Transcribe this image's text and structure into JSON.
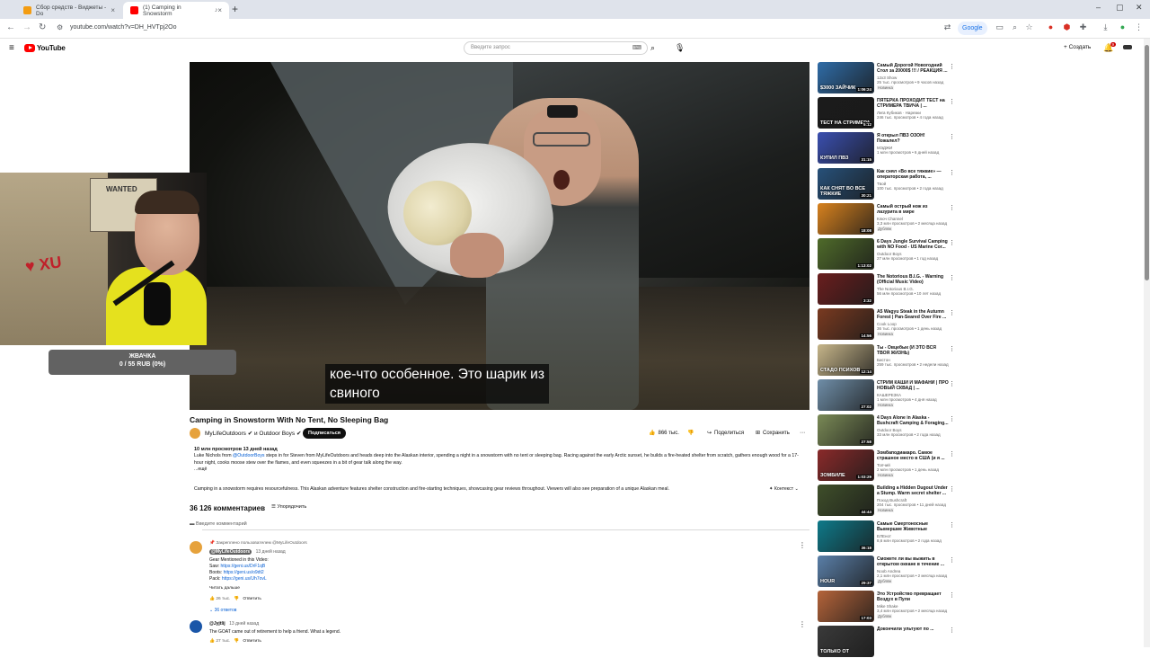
{
  "browser": {
    "tabs": [
      {
        "title": "Сбор средств - Виджеты - Do",
        "active": false,
        "favicon_color": "#f39c12"
      },
      {
        "title": "(1) Camping in Snowstorm",
        "active": true,
        "favicon_color": "#ff0000"
      }
    ],
    "url": "youtube.com/watch?v=DH_HVTpj2Oo",
    "google_button": "Google"
  },
  "masthead": {
    "logo_text": "YouTube",
    "search_placeholder": "Введите запрос",
    "create_label": "Создать",
    "notifications_count": "9"
  },
  "player": {
    "subtitle_line1": "кое-что особенное.  Это шарик из",
    "subtitle_line2": "свиного"
  },
  "overlay": {
    "donation_title": "ЖВАЧКА",
    "donation_progress": "0 / 55 RUB (0%)",
    "donation_fraction": 0
  },
  "video": {
    "title": "Camping in Snowstorm With No Tent, No Sleeping Bag",
    "channel": "MyLifeOutdoors",
    "channel_suffix": "и Outdoor Boys",
    "subscribe_label": "Подписаться",
    "likes": "866 тыс.",
    "share_label": "Поделиться",
    "save_label": "Сохранить",
    "stats": "10 млн просмотров  13 дней назад",
    "description_line1_a": "Luke Nichols from ",
    "description_link": "@OutdoorBoys",
    "description_line1_b": "  steps in for Steven from MyLifeOutdoors and heads deep into the Alaskan interior, spending a night in a snowstorm with no tent or sleeping bag. Racing against the early Arctic sunset, he builds a fire-heated shelter from scratch, gathers enough wood for a 17-",
    "description_line2": "hour night, cooks moose stew over the flames, and even squeezes in a bit of gear talk along the way.",
    "more_label": "...ещё",
    "summary": "Camping in a snowstorm requires resourcefulness. This Alaskan adventure features shelter construction and fire-starting techniques, showcasing gear reviews throughout. Viewers will also see preparation of a unique Alaskan meal.",
    "context_label": "Контекст"
  },
  "comments": {
    "count": "36 126 комментариев",
    "sort_label": "Упорядочить",
    "input_placeholder": "Введите комментарий",
    "items": [
      {
        "pinned_label": "Закреплено пользователем @MyLifeOutdoors",
        "author": "@MyLifeOutdoors",
        "time": "13 дней назад",
        "lines": [
          {
            "text": "Gear Mentioned in this Video:",
            "link": ""
          },
          {
            "text": "Saw: ",
            "link": "https://geni.us/DrF1qB"
          },
          {
            "text": "Boots: ",
            "link": "https://geni.us/o9dt2"
          },
          {
            "text": "Pack: ",
            "link": "https://geni.us/Uh7ovL"
          }
        ],
        "read_more": "Читать дальше",
        "likes": "26 тыс.",
        "reply_label": "Ответить",
        "replies_label": "36 ответов",
        "avatar_color": "#e6a23c"
      },
      {
        "author": "@Jyjtlij",
        "time": "13 дней назад",
        "lines": [
          {
            "text": "The GOAT came out of retirement to help a friend.  What a legend.",
            "link": ""
          }
        ],
        "likes": "27 тыс.",
        "reply_label": "Ответить",
        "avatar_color": "#1a56a8"
      }
    ]
  },
  "sidebar": [
    {
      "title": "Самый Дорогой Новогодний Стол за 20000$ !!! / РЕАКЦИЯ ...",
      "channel": "12x3 Show",
      "stats": "25 тыс. просмотров • 9 часов назад",
      "badge": "Новинка",
      "duration": "1:06:24",
      "overlay": "$3000 ЗАЙЧИК",
      "color": "#2f6ca7"
    },
    {
      "title": "ПЯТЁРКА ПРОХОДИТ ТЕСТ на СТРИМЕРА ТВИЧА | ...",
      "channel": "Лига Кубиков · Нарезки",
      "stats": "246 тыс. просмотров • 4 года назад",
      "badge": "",
      "duration": "5:12",
      "overlay": "ТЕСТ НА СТРИМЕРА",
      "color": "#1b1b1b"
    },
    {
      "title": "Я открыл ПВЗ ОЗОН! Пожалел?",
      "channel": "МЭДЖИ",
      "stats": "1 млн просмотров • 6 дней назад",
      "badge": "",
      "duration": "31:15",
      "overlay": "КУПИЛ ПВЗ",
      "color": "#3a4fb0"
    },
    {
      "title": "Как снял «Во все тяжкие» — операторская работа, ...",
      "channel": "Tвой",
      "stats": "100 тыс. просмотров • 2 года назад",
      "badge": "",
      "duration": "30:21",
      "overlay": "КАК СНЯТ ВО ВСЕ ТЯЖКИЕ",
      "color": "#27517a"
    },
    {
      "title": "Самый острый нож из лазурита в мире",
      "channel": "Ключ Channel",
      "stats": "3,3 млн просмотров • 2 месяца назад",
      "badge": "Дубляж",
      "duration": "18:08",
      "overlay": "",
      "color": "#d8821e"
    },
    {
      "title": "6 Days Jungle Survival Camping with NO Food - US Marine Cor...",
      "channel": "Outdoor Boys",
      "stats": "27 млн просмотров • 1 год назад",
      "badge": "",
      "duration": "1:13:02",
      "overlay": "",
      "color": "#4f6b2a"
    },
    {
      "title": "The Notorious B.I.G. - Warning (Official Music Video)",
      "channel": "The Notorious B.I.G.",
      "stats": "56 млн просмотров • 10 лет назад",
      "badge": "",
      "duration": "3:32",
      "overlay": "",
      "color": "#6a1e1e"
    },
    {
      "title": "A5 Wagyu Steak in the Autumn Forest | Pan-Seared Over Fire ...",
      "channel": "Cook Loop",
      "stats": "36 тыс. просмотров • 1 день назад",
      "badge": "Новинка",
      "duration": "14:56",
      "overlay": "",
      "color": "#7a3a20"
    },
    {
      "title": "Ты - Овцебык (И ЭТО ВСЯ ТВОЯ ЖИЗНЬ)",
      "channel": "Бистон",
      "stats": "259 тыс. просмотров • 2 недели назад",
      "badge": "",
      "duration": "12:14",
      "overlay": "СТАДО ПСИХОВ",
      "color": "#c7b68a"
    },
    {
      "title": "СТРИМ КАШИ И МАФАНИ | ПРО НОВЫЙ СКВАД | ...",
      "channel": "КАШЕРЕЗКА",
      "stats": "1 млн просмотров • 4 дня назад",
      "badge": "Новинка",
      "duration": "27:02",
      "overlay": "",
      "color": "#6f8ea8"
    },
    {
      "title": "4 Days Alone in Alaska - Bushcraft Camping & Foraging...",
      "channel": "Outdoor Boys",
      "stats": "33 млн просмотров • 2 года назад",
      "badge": "",
      "duration": "27:58",
      "overlay": "",
      "color": "#7a8a56"
    },
    {
      "title": "Зомбаподиакаро. Самое страшное место в США (и я ...",
      "channel": "Топчий",
      "stats": "2 млн просмотров • 1 день назад",
      "badge": "Новинка",
      "duration": "1:03:29",
      "overlay": "ЗОМБИЛЕ",
      "color": "#8a2a2a"
    },
    {
      "title": "Building a Hidden Dugout Under a Stump. Warm secret shelter ...",
      "channel": "Поход Bushcraft",
      "stats": "204 тыс. просмотров • 11 дней назад",
      "badge": "Новинка",
      "duration": "44:44",
      "overlay": "",
      "color": "#3f4f2a"
    },
    {
      "title": "Самые Смертоносные Вымершие Животные",
      "channel": "ЕЛЕнот",
      "stats": "8,6 млн просмотров • 2 года назад",
      "badge": "",
      "duration": "36:18",
      "overlay": "",
      "color": "#0e7a8a"
    },
    {
      "title": "Сможете ли вы выжить в открытом океане в течение ...",
      "channel": "Noob Andrea",
      "stats": "2,1 млн просмотров • 2 месяца назад",
      "badge": "Дубляж",
      "duration": "29:37",
      "overlay": "HOUR",
      "color": "#5a7fa8"
    },
    {
      "title": "Это Устройство превращает Воздух в Пули",
      "channel": "Mike Shake",
      "stats": "3,4 млн просмотров • 2 месяца назад",
      "badge": "Дубляж",
      "duration": "17:03",
      "overlay": "",
      "color": "#b5643a"
    },
    {
      "title": "Докончили ультуют по ...",
      "channel": "",
      "stats": "",
      "badge": "",
      "duration": "",
      "overlay": "ТОЛЬКО ОТ",
      "color": "#3a3a3a"
    }
  ]
}
